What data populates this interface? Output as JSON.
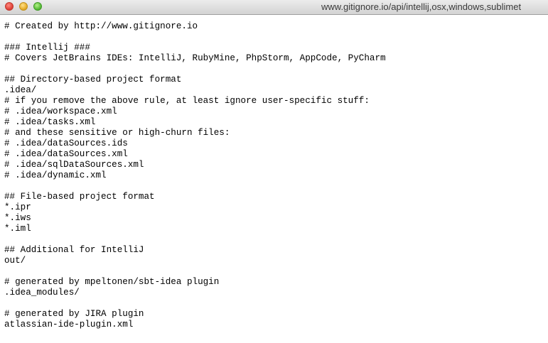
{
  "window": {
    "title": "www.gitignore.io/api/intellij,osx,windows,sublimet"
  },
  "content": {
    "lines": [
      "# Created by http://www.gitignore.io",
      "",
      "### Intellij ###",
      "# Covers JetBrains IDEs: IntelliJ, RubyMine, PhpStorm, AppCode, PyCharm",
      "",
      "## Directory-based project format",
      ".idea/",
      "# if you remove the above rule, at least ignore user-specific stuff:",
      "# .idea/workspace.xml",
      "# .idea/tasks.xml",
      "# and these sensitive or high-churn files:",
      "# .idea/dataSources.ids",
      "# .idea/dataSources.xml",
      "# .idea/sqlDataSources.xml",
      "# .idea/dynamic.xml",
      "",
      "## File-based project format",
      "*.ipr",
      "*.iws",
      "*.iml",
      "",
      "## Additional for IntelliJ",
      "out/",
      "",
      "# generated by mpeltonen/sbt-idea plugin",
      ".idea_modules/",
      "",
      "# generated by JIRA plugin",
      "atlassian-ide-plugin.xml"
    ]
  }
}
